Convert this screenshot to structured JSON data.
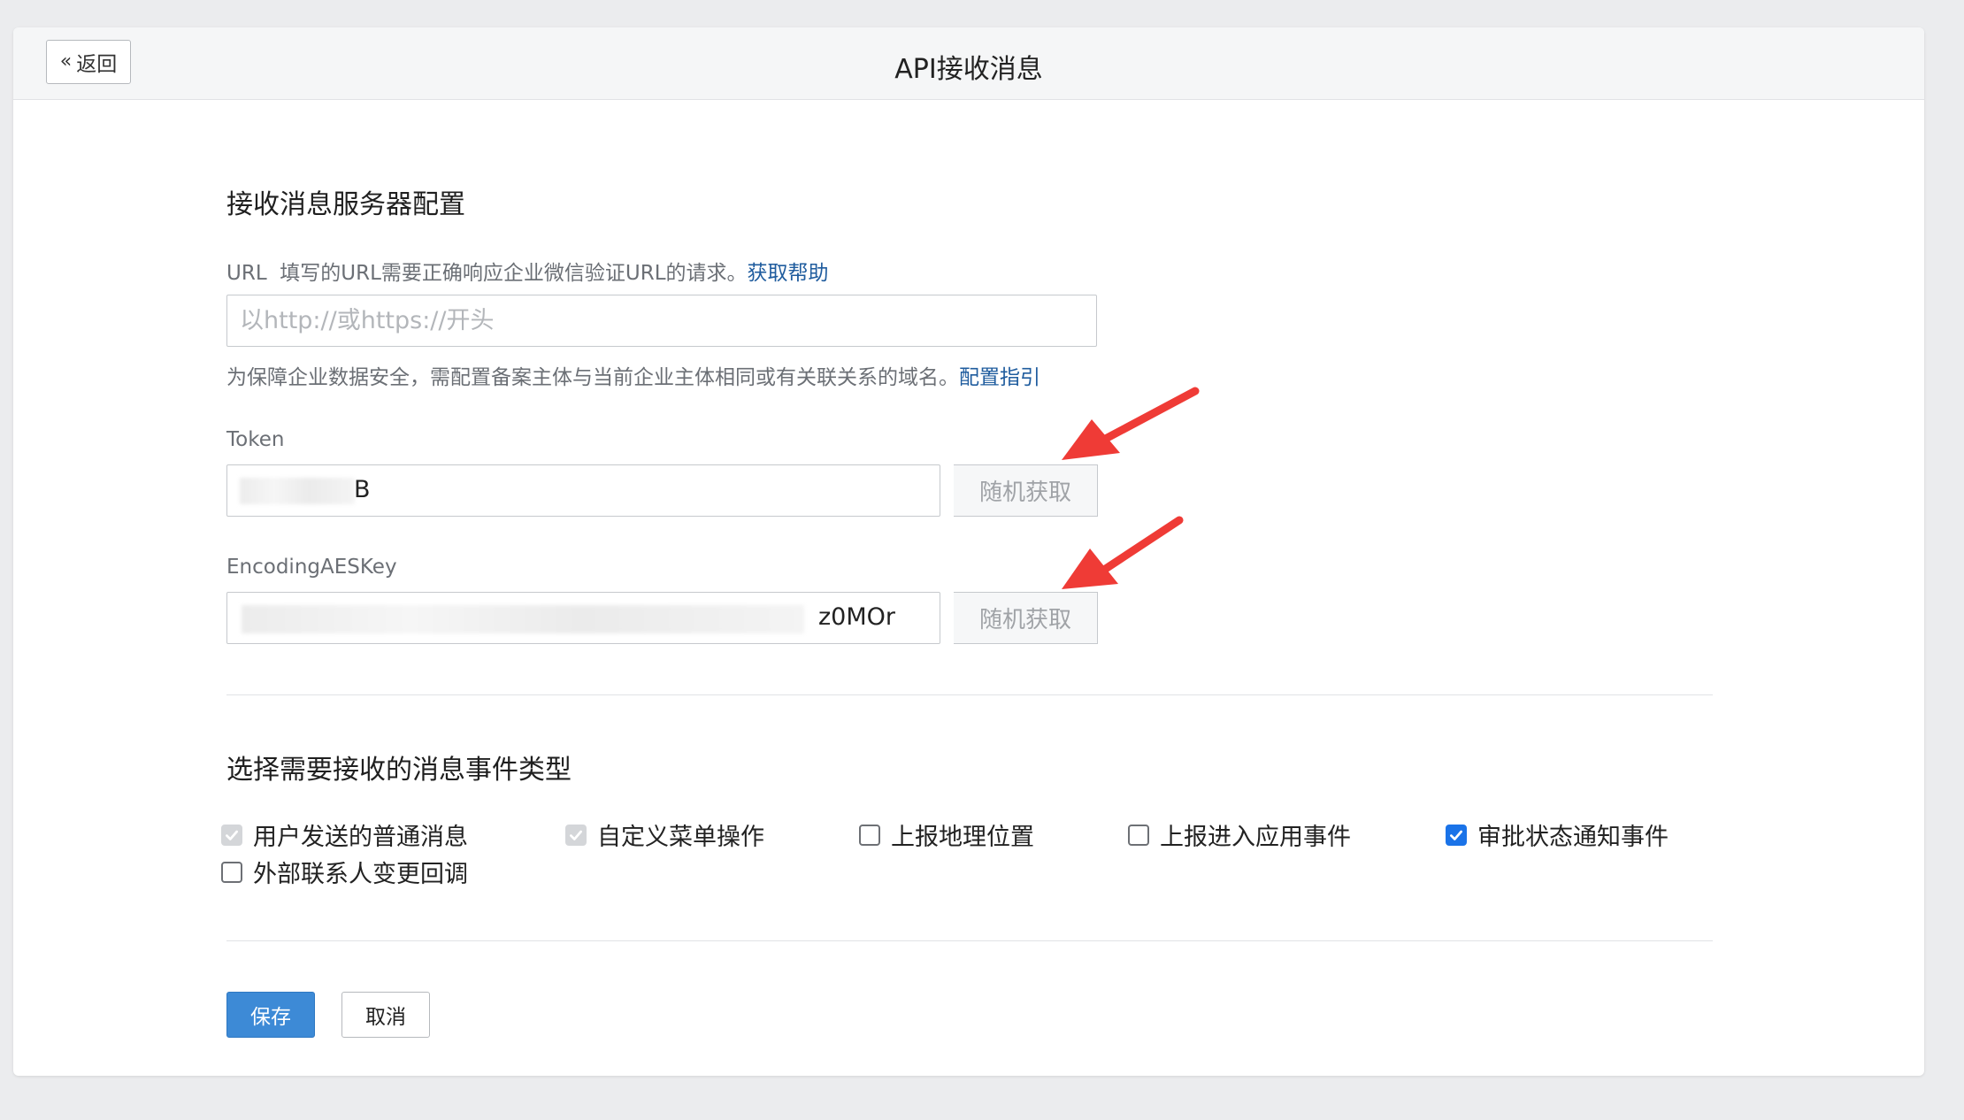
{
  "header": {
    "back_icon": "«",
    "back_label": "返回",
    "title": "API接收消息"
  },
  "server_config": {
    "section_title": "接收消息服务器配置",
    "url_label_prefix": "URL",
    "url_label_desc": "填写的URL需要正确响应企业微信验证URL的请求。",
    "url_help_link": "获取帮助",
    "url_placeholder": "以http://或https://开头",
    "url_value": "",
    "domain_hint": "为保障企业数据安全，需配置备案主体与当前企业主体相同或有关联关系的域名。",
    "domain_hint_link": "配置指引",
    "token_label": "Token",
    "token_value_visible": "B",
    "token_random_button": "随机获取",
    "aeskey_label": "EncodingAESKey",
    "aeskey_value_visible": "z0MOr",
    "aeskey_random_button": "随机获取"
  },
  "event_types": {
    "section_title": "选择需要接收的消息事件类型",
    "options": [
      {
        "label": "用户发送的普通消息",
        "checked": true,
        "disabled": true
      },
      {
        "label": "自定义菜单操作",
        "checked": true,
        "disabled": true
      },
      {
        "label": "上报地理位置",
        "checked": false,
        "disabled": false
      },
      {
        "label": "上报进入应用事件",
        "checked": false,
        "disabled": false
      },
      {
        "label": "审批状态通知事件",
        "checked": true,
        "disabled": false
      },
      {
        "label": "外部联系人变更回调",
        "checked": false,
        "disabled": false
      }
    ]
  },
  "actions": {
    "save_label": "保存",
    "cancel_label": "取消"
  },
  "colors": {
    "primary": "#3d8ad6",
    "link": "#1f5c9e",
    "checkbox_checked": "#1a73e8",
    "annotation_arrow": "#ef3b36"
  }
}
